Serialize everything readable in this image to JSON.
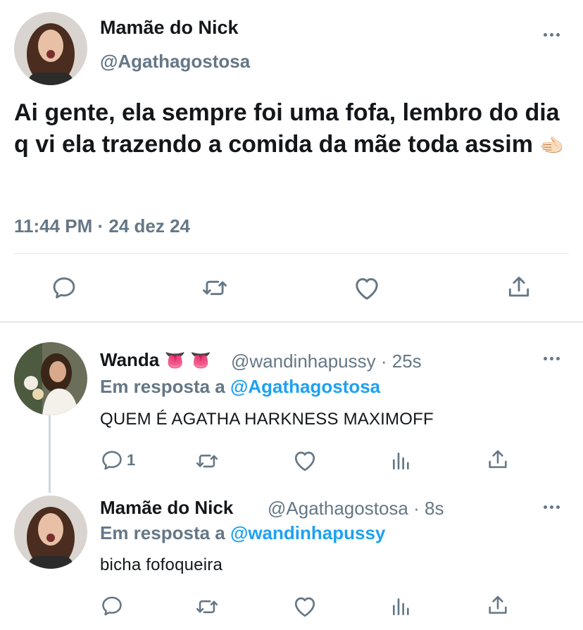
{
  "main_tweet": {
    "author_name": "Mamãe do Nick",
    "author_handle": "@Agathagostosa",
    "text": "Ai gente, ela sempre foi uma fofa, lembro do dia q vi ela trazendo a comida da mãe toda assim",
    "emoji": "🫲🏻",
    "timestamp": "11:44 PM · 24 dez 24",
    "actions": [
      "reply-icon",
      "retweet-icon",
      "like-icon",
      "share-icon"
    ]
  },
  "replies": [
    {
      "author_name": "Wanda",
      "name_emoji": "👅 👅",
      "handle": "@wandinhapussy",
      "time": "· 25s",
      "in_reply_label": "Em resposta a",
      "in_reply_to": "@Agathagostosa",
      "text": "QUEM É AGATHA HARKNESS MAXIMOFF",
      "reply_count": "1",
      "actions": [
        "reply-icon",
        "retweet-icon",
        "like-icon",
        "analytics-icon",
        "share-icon"
      ]
    },
    {
      "author_name": "Mamãe do Nick",
      "name_emoji": "",
      "handle": "@Agathagostosa",
      "time": "· 8s",
      "in_reply_label": "Em resposta a",
      "in_reply_to": "@wandinhapussy",
      "text": "bicha fofoqueira",
      "reply_count": "",
      "actions": [
        "reply-icon",
        "retweet-icon",
        "like-icon",
        "analytics-icon",
        "share-icon"
      ]
    }
  ],
  "colors": {
    "text": "#14171a",
    "secondary": "#657786",
    "link": "#1da1f2",
    "divider": "#e1e8ed"
  }
}
